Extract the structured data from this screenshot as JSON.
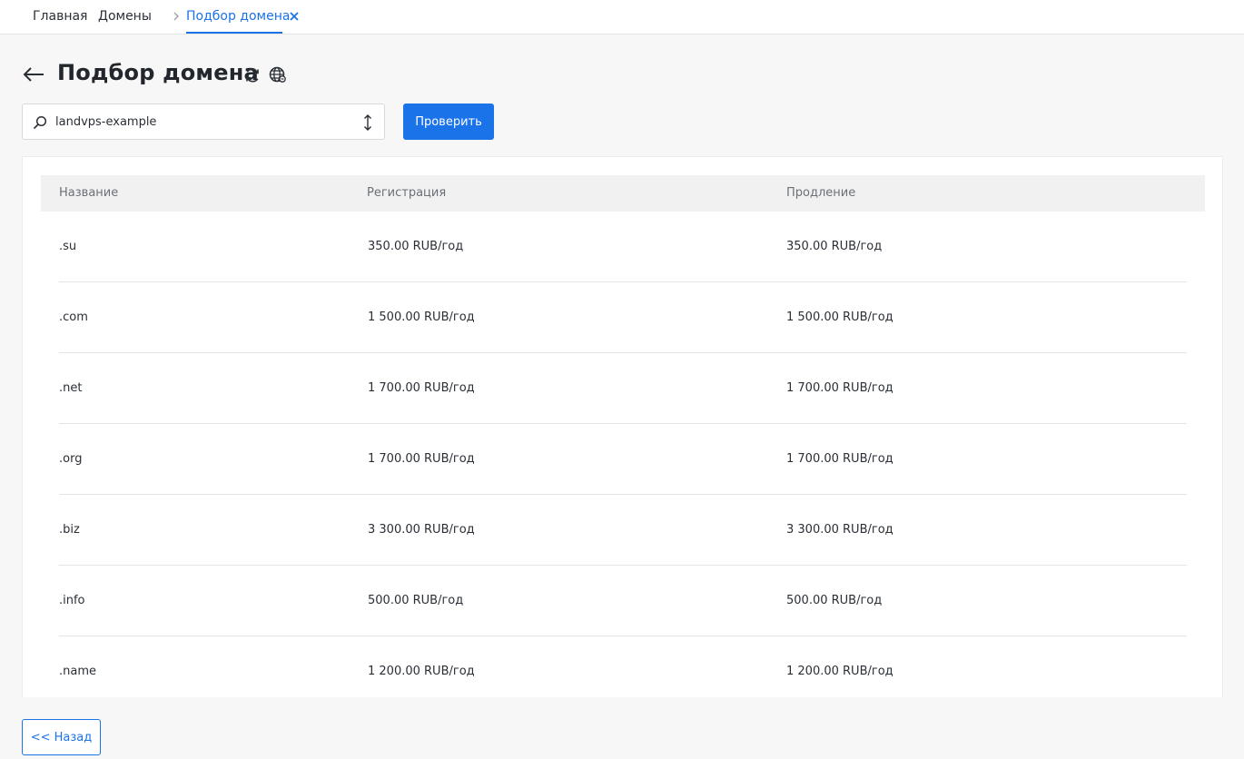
{
  "tabs": {
    "home": "Главная",
    "domains": "Домены",
    "active": "Подбор домена"
  },
  "page": {
    "title": "Подбор домена"
  },
  "search": {
    "value": "landvps-example",
    "button_label": "Проверить"
  },
  "table": {
    "headers": {
      "name": "Название",
      "registration": "Регистрация",
      "renewal": "Продление"
    },
    "rows": [
      {
        "name": ".su",
        "registration": "350.00 RUB/год",
        "renewal": "350.00 RUB/год"
      },
      {
        "name": ".com",
        "registration": "1 500.00 RUB/год",
        "renewal": "1 500.00 RUB/год"
      },
      {
        "name": ".net",
        "registration": "1 700.00 RUB/год",
        "renewal": "1 700.00 RUB/год"
      },
      {
        "name": ".org",
        "registration": "1 700.00 RUB/год",
        "renewal": "1 700.00 RUB/год"
      },
      {
        "name": ".biz",
        "registration": "3 300.00 RUB/год",
        "renewal": "3 300.00 RUB/год"
      },
      {
        "name": ".info",
        "registration": "500.00 RUB/год",
        "renewal": "500.00 RUB/год"
      },
      {
        "name": ".name",
        "registration": "1 200.00 RUB/год",
        "renewal": "1 200.00 RUB/год"
      }
    ]
  },
  "footer": {
    "back_label": "<< Назад"
  },
  "colors": {
    "accent": "#1a73e8",
    "background": "#f7f7f7",
    "text": "#2a2f36"
  }
}
